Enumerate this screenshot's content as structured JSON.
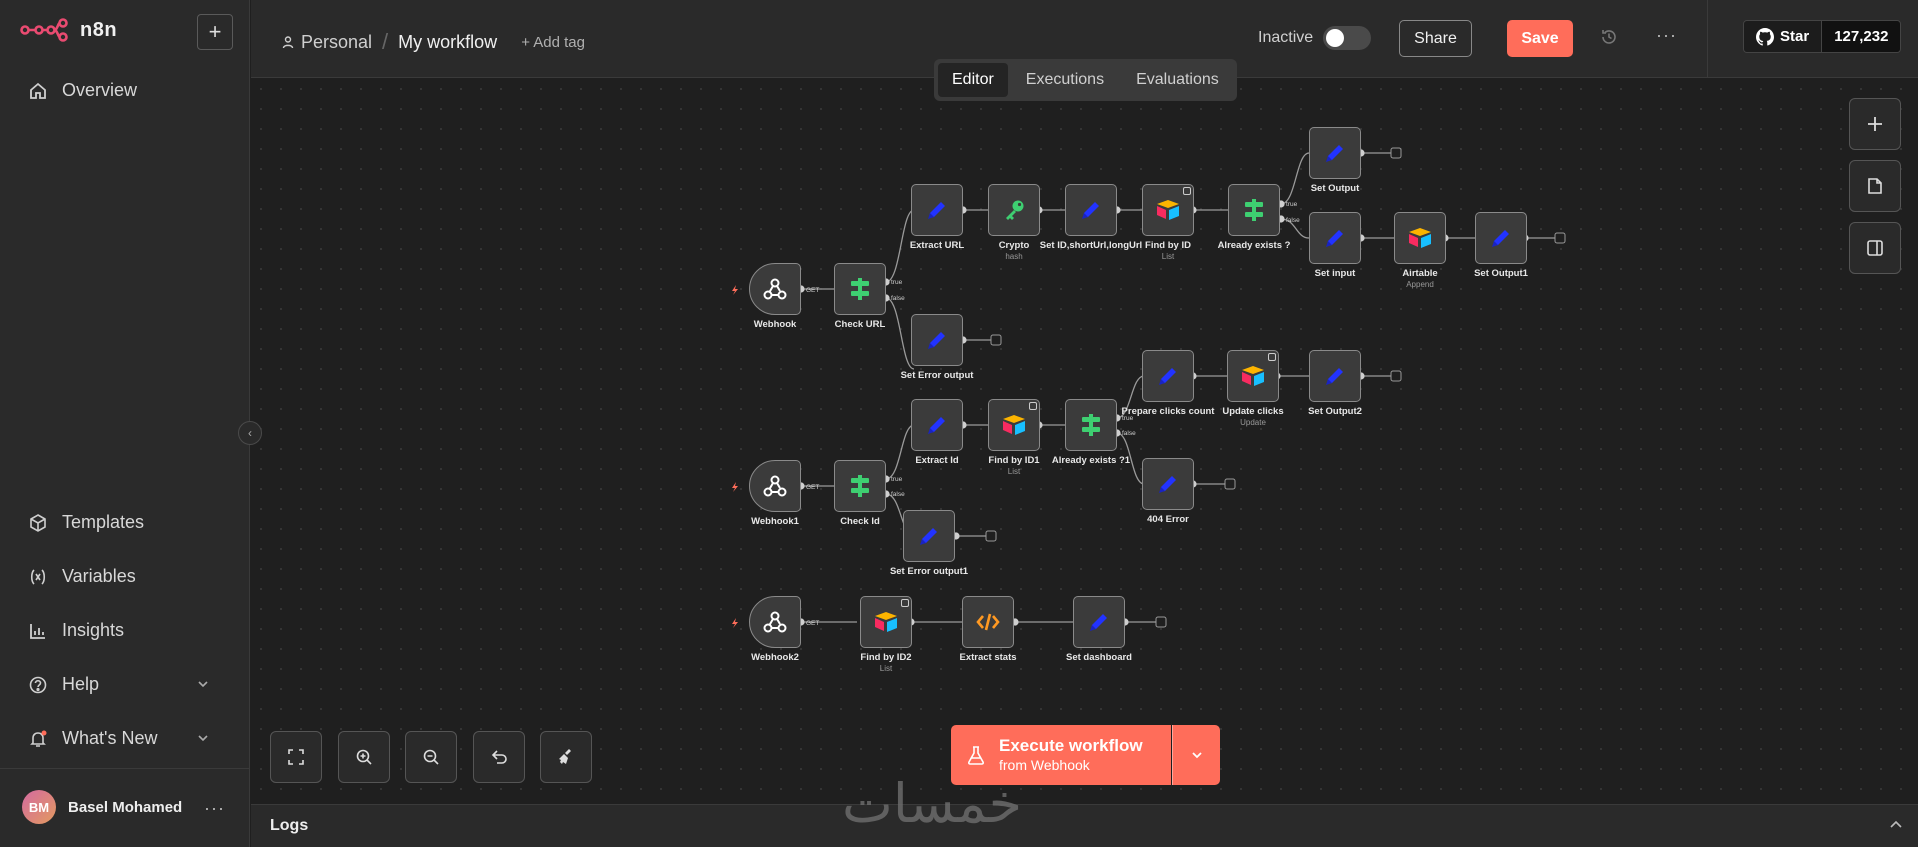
{
  "app": {
    "name": "n8n"
  },
  "sidebar": {
    "items": [
      {
        "label": "Overview",
        "icon": "home-icon"
      },
      {
        "label": "Templates",
        "icon": "box-icon"
      },
      {
        "label": "Variables",
        "icon": "variable-icon"
      },
      {
        "label": "Insights",
        "icon": "chart-icon"
      },
      {
        "label": "Help",
        "icon": "help-icon"
      },
      {
        "label": "What's New",
        "icon": "bell-icon"
      }
    ],
    "user": {
      "initials": "BM",
      "name": "Basel Mohamed"
    }
  },
  "header": {
    "project": "Personal",
    "workflow_name": "My workflow",
    "add_tag": "+ Add tag",
    "status": "Inactive",
    "share": "Share",
    "save": "Save",
    "github_star": "Star",
    "github_count": "127,232"
  },
  "tabs": [
    "Editor",
    "Executions",
    "Evaluations"
  ],
  "nodes": {
    "webhook": {
      "label": "Webhook",
      "method": "GET"
    },
    "check_url": {
      "label": "Check URL"
    },
    "extract_url": {
      "label": "Extract URL"
    },
    "crypto": {
      "label": "Crypto",
      "sub": "hash"
    },
    "set_id": {
      "label": "Set ID,shortUrl,longUrl"
    },
    "find_by_id": {
      "label": "Find by ID",
      "sub": "List"
    },
    "already_exists": {
      "label": "Already exists ?"
    },
    "set_output": {
      "label": "Set Output"
    },
    "set_input": {
      "label": "Set input"
    },
    "airtable": {
      "label": "Airtable",
      "sub": "Append"
    },
    "set_output1": {
      "label": "Set Output1"
    },
    "set_error_output": {
      "label": "Set Error output"
    },
    "webhook1": {
      "label": "Webhook1",
      "method": "GET"
    },
    "check_id": {
      "label": "Check Id"
    },
    "extract_id": {
      "label": "Extract Id"
    },
    "find_by_id1": {
      "label": "Find by ID1",
      "sub": "List"
    },
    "already_exists1": {
      "label": "Already exists ?1"
    },
    "prepare_clicks": {
      "label": "Prepare clicks count"
    },
    "update_clicks": {
      "label": "Update clicks",
      "sub": "Update"
    },
    "set_output2": {
      "label": "Set Output2"
    },
    "error_404": {
      "label": "404 Error"
    },
    "set_error_output1": {
      "label": "Set Error output1"
    },
    "webhook2": {
      "label": "Webhook2",
      "method": "GET"
    },
    "find_by_id2": {
      "label": "Find by ID2",
      "sub": "List"
    },
    "extract_stats": {
      "label": "Extract stats"
    },
    "set_dashboard": {
      "label": "Set dashboard"
    }
  },
  "branch": {
    "true": "true",
    "false": "false"
  },
  "execute": {
    "main": "Execute workflow",
    "sub": "from Webhook"
  },
  "logs": {
    "label": "Logs"
  },
  "watermark": "خمسات"
}
